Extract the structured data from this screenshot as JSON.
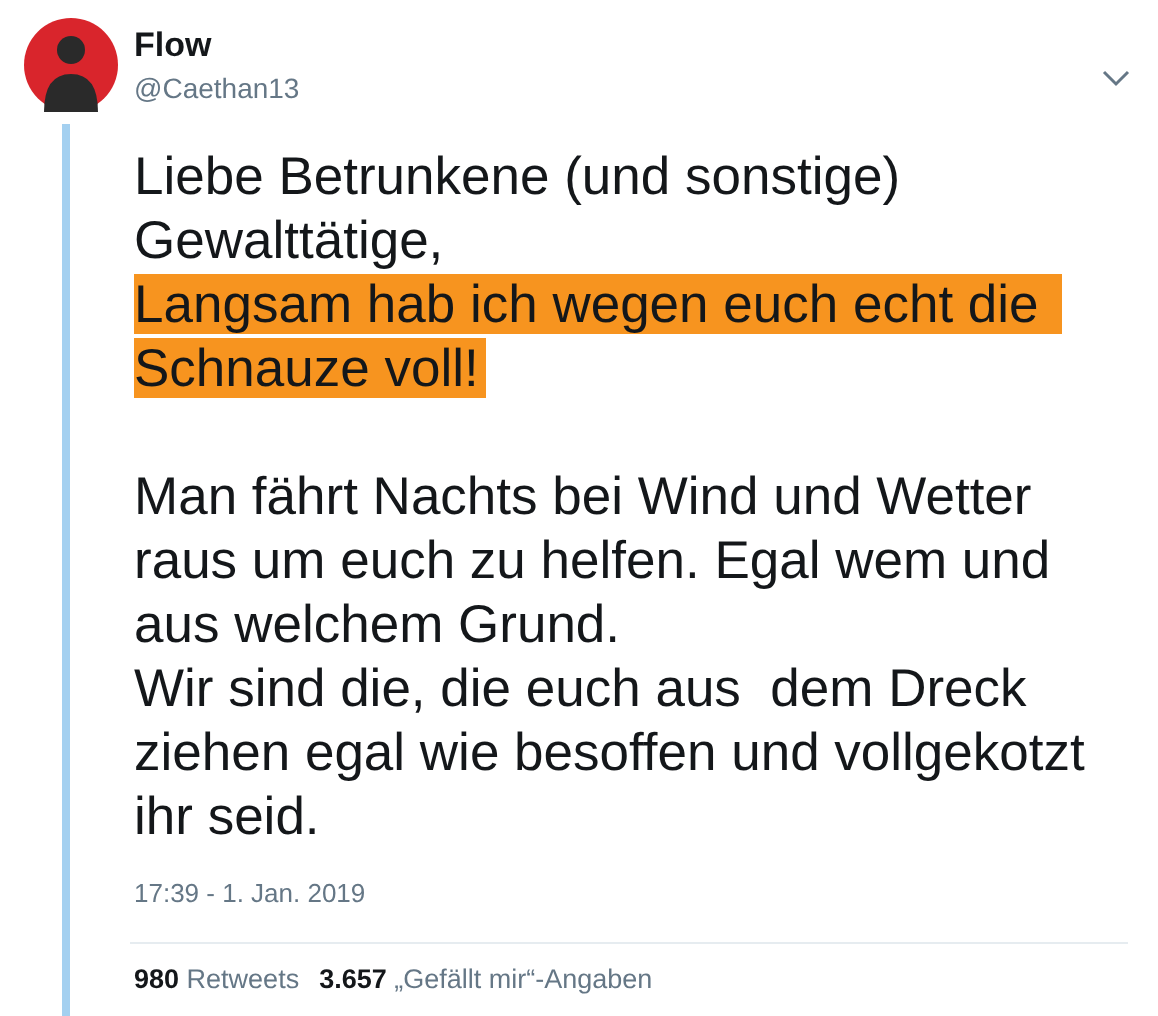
{
  "author": {
    "name": "Flow",
    "handle": "@Caethan13"
  },
  "body": [
    {
      "text": "Liebe Betrunkene (und sonstige) Gewalttätige,",
      "highlighted": false,
      "space_before": false
    },
    {
      "text": "Langsam hab ich wegen euch echt die Schnauze voll!",
      "highlighted": true,
      "space_before": false
    },
    {
      "text": "Man fährt Nachts bei Wind und Wetter raus um euch zu helfen. Egal wem und aus welchem Grund.",
      "highlighted": false,
      "space_before": true
    },
    {
      "text": "Wir sind die, die euch aus  dem Dreck ziehen egal wie besoffen und vollgekotzt ihr seid.",
      "highlighted": false,
      "space_before": false
    }
  ],
  "timestamp": "17:39 - 1. Jan. 2019",
  "stats": [
    {
      "count": "980",
      "label": "Retweets"
    },
    {
      "count": "3.657",
      "label": "„Gefällt mir“-Angaben"
    }
  ]
}
